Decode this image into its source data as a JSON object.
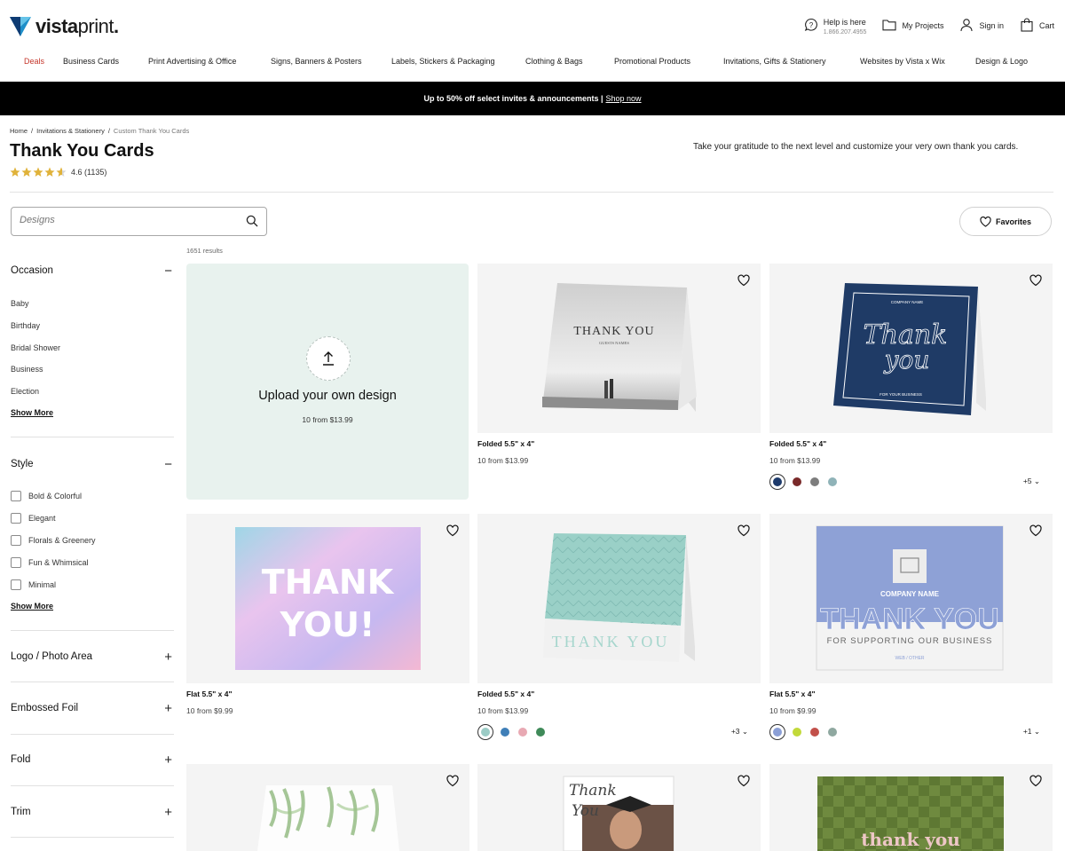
{
  "brand": {
    "name_bold": "vista",
    "name_light": "print",
    "trademark": "."
  },
  "header": {
    "help": {
      "label": "Help is here",
      "phone": "1.866.207.4955"
    },
    "projects": "My Projects",
    "signin": "Sign in",
    "cart": "Cart"
  },
  "nav": [
    "Deals",
    "Business Cards",
    "Print Advertising & Office",
    "Signs, Banners & Posters",
    "Labels, Stickers & Packaging",
    "Clothing & Bags",
    "Promotional Products",
    "Invitations, Gifts & Stationery",
    "Websites by Vista x Wix",
    "Design & Logo"
  ],
  "promo": {
    "text": "Up to 50% off select invites & announcements |",
    "link": "Shop now"
  },
  "breadcrumb": [
    "Home",
    "Invitations & Stationery",
    "Custom Thank You Cards"
  ],
  "page": {
    "title": "Thank You Cards",
    "rating": "4.6",
    "rating_count": "(1135)",
    "intro": "Take your gratitude to the next level and customize your very own thank you cards."
  },
  "search": {
    "placeholder": "Designs"
  },
  "favorites": "Favorites",
  "results": "1651 results",
  "filters": {
    "occasion": {
      "title": "Occasion",
      "toggle": "−",
      "items": [
        "Baby",
        "Birthday",
        "Bridal Shower",
        "Business",
        "Election"
      ],
      "show_more": "Show More"
    },
    "style": {
      "title": "Style",
      "toggle": "−",
      "items": [
        "Bold & Colorful",
        "Elegant",
        "Florals & Greenery",
        "Fun & Whimsical",
        "Minimal"
      ],
      "show_more": "Show More"
    },
    "collapsed": [
      {
        "title": "Logo / Photo Area",
        "toggle": "+"
      },
      {
        "title": "Embossed Foil",
        "toggle": "+"
      },
      {
        "title": "Fold",
        "toggle": "+"
      },
      {
        "title": "Trim",
        "toggle": "+"
      }
    ]
  },
  "upload": {
    "title": "Upload your own design",
    "price": "10 from $13.99"
  },
  "products": [
    {
      "title": "Folded 5.5\" x 4\"",
      "price": "10 from $13.99",
      "art": {
        "line1": "THANK YOU",
        "line2": "GUESTS NAMES"
      }
    },
    {
      "title": "Folded 5.5\" x 4\"",
      "price": "10 from $13.99",
      "swatches": [
        "#1d3a6b",
        "#7a2a2a",
        "#7d7d7d",
        "#8fb3b8"
      ],
      "more": "+5",
      "art": {
        "top": "COMPANY NAME",
        "script1": "Thank",
        "script2": "you",
        "bottom": "FOR YOUR BUSINESS"
      }
    },
    {
      "title": "Flat 5.5\" x 4\"",
      "price": "10 from $9.99",
      "art": {
        "line1": "THANK",
        "line2": "YOU!"
      }
    },
    {
      "title": "Folded 5.5\" x 4\"",
      "price": "10 from $13.99",
      "swatches": [
        "#9cccc6",
        "#3f7fb8",
        "#e8a9b3",
        "#3f8a59"
      ],
      "more": "+3",
      "art": {
        "line1": "THANK YOU"
      }
    },
    {
      "title": "Flat 5.5\" x 4\"",
      "price": "10 from $9.99",
      "swatches": [
        "#8b9fd6",
        "#c2d93a",
        "#c2504a",
        "#8fa8a0"
      ],
      "more": "+1",
      "art": {
        "top": "COMPANY NAME",
        "big": "THANK YOU",
        "sub": "FOR SUPPORTING OUR BUSINESS",
        "web": "WEB / OTHER"
      }
    },
    {
      "art": {}
    },
    {
      "art": {
        "script1": "Thank",
        "script2": "You"
      }
    },
    {
      "art": {
        "line1": "thank you"
      }
    }
  ],
  "colors": {
    "deals": "#c5362b",
    "star": "#e0b23a",
    "upload_bg": "#e8f2ee",
    "promo_bg": "#000000"
  }
}
